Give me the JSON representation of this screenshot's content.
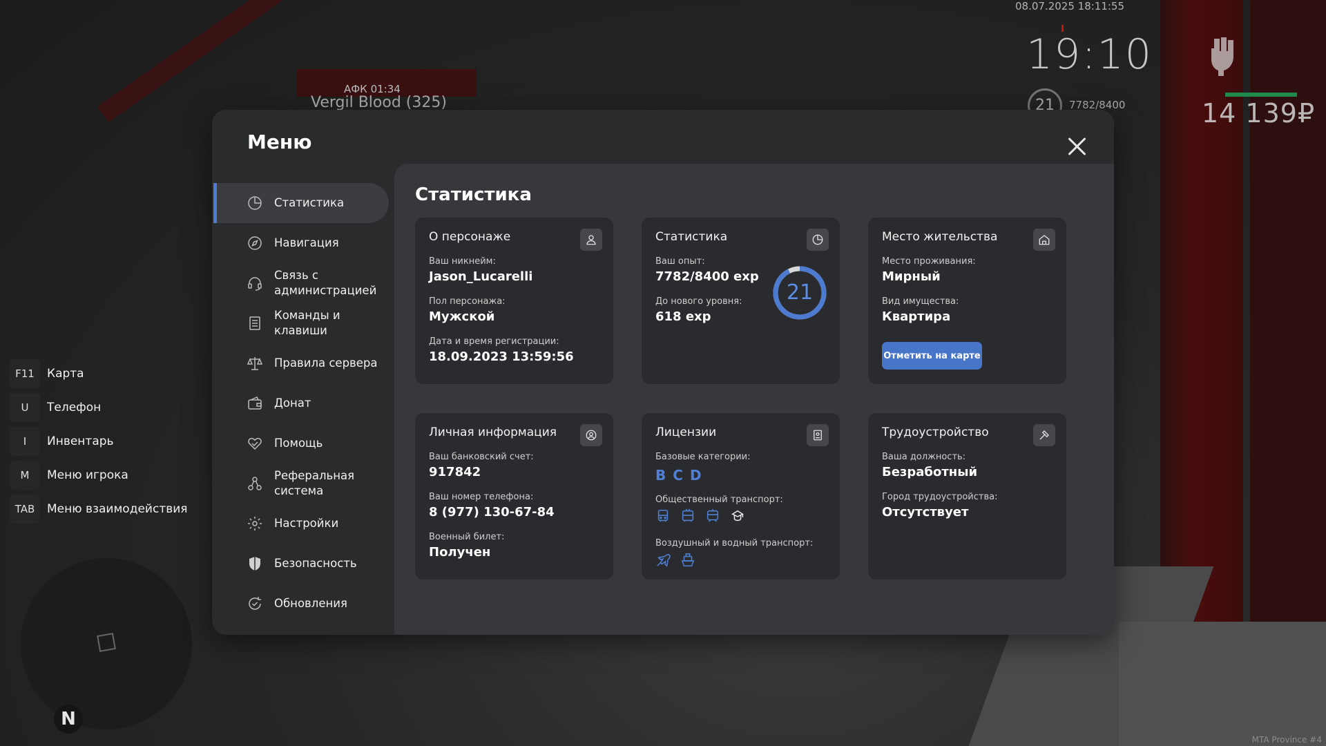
{
  "hud": {
    "date": "08.07.2025 18:11:55",
    "clock": "19:10",
    "level": "21",
    "exp": "7782/8400",
    "money": "14 139₽",
    "afk": "АФК 01:34",
    "player": "Vergil Blood (325)",
    "server": "MTA Province #4"
  },
  "hotkeys": [
    {
      "key": "F11",
      "label": "Карта"
    },
    {
      "key": "U",
      "label": "Телефон"
    },
    {
      "key": "I",
      "label": "Инвентарь"
    },
    {
      "key": "M",
      "label": "Меню игрока"
    },
    {
      "key": "TAB",
      "label": "Меню взаимодействия"
    }
  ],
  "minimap": {
    "north": "N"
  },
  "menu": {
    "title": "Меню",
    "nav": [
      {
        "label": "Статистика",
        "icon": "stats-icon"
      },
      {
        "label": "Навигация",
        "icon": "compass-icon"
      },
      {
        "label": "Связь с администрацией",
        "icon": "headset-icon"
      },
      {
        "label": "Команды и клавиши",
        "icon": "document-icon"
      },
      {
        "label": "Правила сервера",
        "icon": "scales-icon"
      },
      {
        "label": "Донат",
        "icon": "wallet-icon"
      },
      {
        "label": "Помощь",
        "icon": "helping-hand-icon"
      },
      {
        "label": "Реферальная система",
        "icon": "referral-icon"
      },
      {
        "label": "Настройки",
        "icon": "gear-icon"
      },
      {
        "label": "Безопасность",
        "icon": "shield-icon"
      },
      {
        "label": "Обновления",
        "icon": "refresh-icon"
      }
    ]
  },
  "content": {
    "title": "Статистика",
    "character": {
      "title": "О персонаже",
      "nick_label": "Ваш никнейм:",
      "nick": "Jason_Lucarelli",
      "gender_label": "Пол персонажа:",
      "gender": "Мужской",
      "reg_label": "Дата и время регистрации:",
      "reg": "18.09.2023 13:59:56"
    },
    "stats": {
      "title": "Статистика",
      "exp_label": "Ваш опыт:",
      "exp": "7782/8400 exp",
      "next_label": "До нового уровня:",
      "next": "618 exp",
      "level": "21",
      "progress": 0.926
    },
    "residence": {
      "title": "Место жительства",
      "place_label": "Место проживания:",
      "place": "Мирный",
      "property_label": "Вид имущества:",
      "property": "Квартира",
      "button": "Отметить на карте"
    },
    "personal": {
      "title": "Личная информация",
      "bank_label": "Ваш банковский счет:",
      "bank": "917842",
      "phone_label": "Ваш номер телефона:",
      "phone": "8 (977) 130-67-84",
      "military_label": "Военный билет:",
      "military": "Получен"
    },
    "licenses": {
      "title": "Лицензии",
      "base_label": "Базовые категории:",
      "categories": [
        "B",
        "C",
        "D"
      ],
      "public_label": "Общественный транспорт:",
      "public_icons": [
        "bus-icon",
        "trolleybus-icon",
        "tram-icon",
        "taxi-icon"
      ],
      "air_label": "Воздушный и водный транспорт:",
      "air_icons": [
        "plane-icon",
        "boat-icon"
      ]
    },
    "employment": {
      "title": "Трудоустройство",
      "position_label": "Ваша должность:",
      "position": "Безработный",
      "city_label": "Город трудоустройства:",
      "city": "Отсутствует"
    }
  },
  "colors": {
    "accent": "#4d7bd1",
    "button": "#4776c9",
    "license": "#4f80d6"
  }
}
